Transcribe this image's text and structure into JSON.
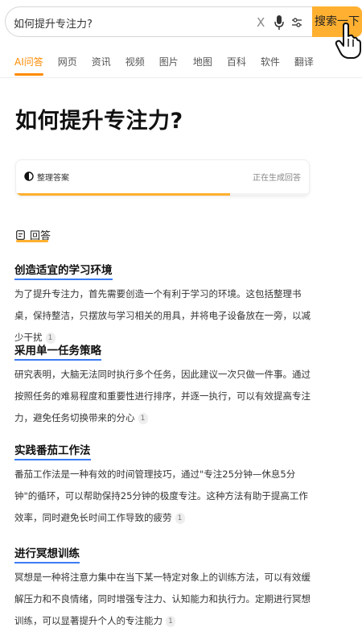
{
  "search": {
    "query": "如何提升专注力?",
    "clear_glyph": "X",
    "button_label": "搜索一下"
  },
  "tabs": [
    {
      "label": "AI问答",
      "active": true
    },
    {
      "label": "网页"
    },
    {
      "label": "资讯"
    },
    {
      "label": "视频"
    },
    {
      "label": "图片"
    },
    {
      "label": "地图"
    },
    {
      "label": "百科"
    },
    {
      "label": "软件"
    },
    {
      "label": "翻译"
    }
  ],
  "page_title": "如何提升专注力?",
  "status_card": {
    "label": "整理答案",
    "status": "正在生成回答",
    "progress": 0.73
  },
  "answer": {
    "heading": "回答",
    "sections": [
      {
        "title": "创造适宜的学习环境",
        "text": "为了提升专注力，首先需要创造一个有利于学习的环境。这包括整理书桌，保持整洁，只摆放与学习相关的用具，并将电子设备放在一旁，以减少干扰",
        "cite": "1"
      },
      {
        "title": "采用单一任务策略",
        "text": "研究表明，大脑无法同时执行多个任务，因此建议一次只做一件事。通过按照任务的难易程度和重要性进行排序，并逐一执行，可以有效提高专注力，避免任务切换带来的分心",
        "cite": "1"
      },
      {
        "title": "实践番茄工作法",
        "text": "番茄工作法是一种有效的时间管理技巧，通过\"专注25分钟—休息5分钟\"的循环，可以帮助保持25分钟的极度专注。这种方法有助于提高工作效率，同时避免长时间工作导致的疲劳",
        "cite": "1"
      },
      {
        "title": "进行冥想训练",
        "text": "冥想是一种将注意力集中在当下某一特定对象上的训练方法，可以有效缓解压力和不良情绪，同时增强专注力、认知能力和执行力。定期进行冥想训练，可以显著提升个人的专注能力",
        "cite": "1"
      }
    ]
  },
  "colors": {
    "accent": "#ff8a00",
    "search_button": "#ffb030",
    "section_underline": "#3b7cf5"
  }
}
